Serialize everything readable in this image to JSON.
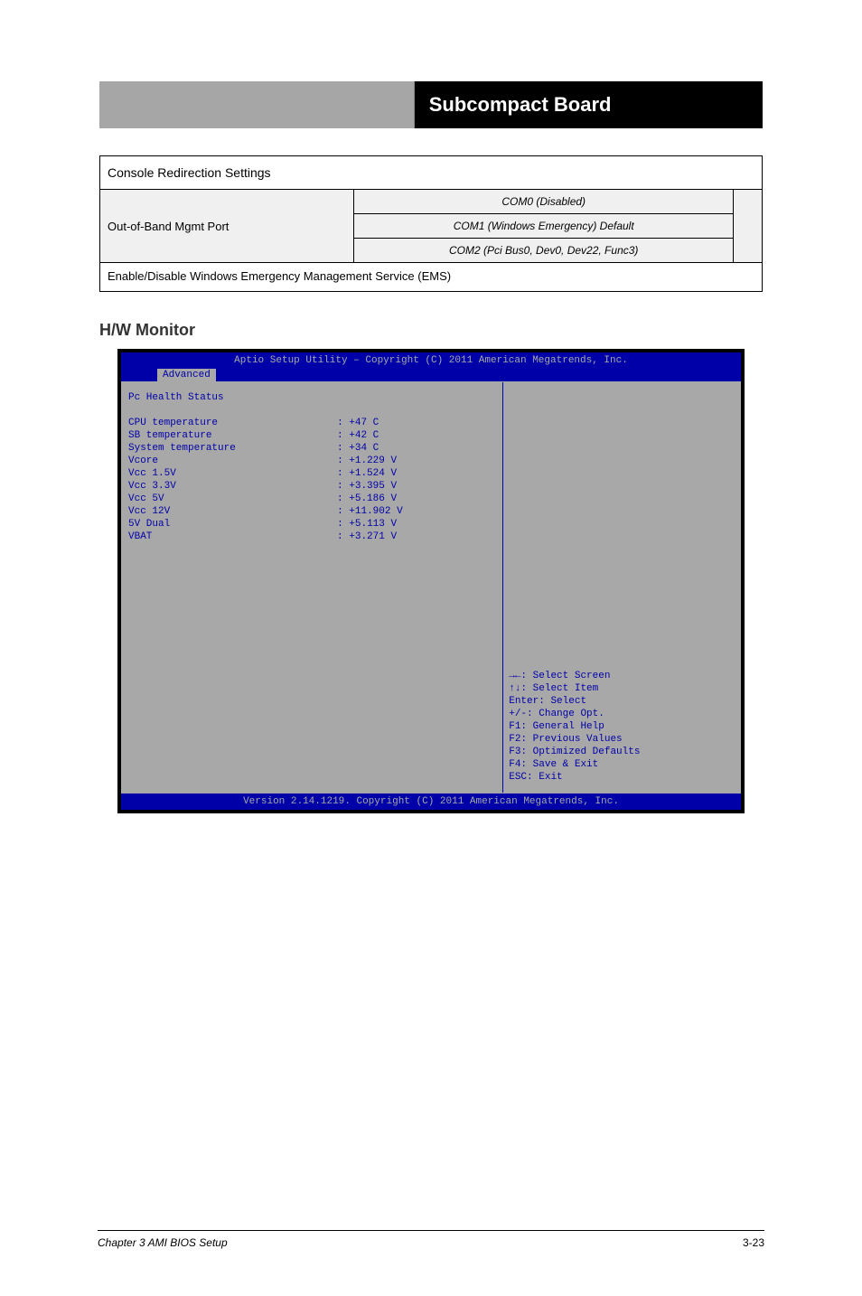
{
  "header": {
    "right": "Subcompact Board"
  },
  "config": {
    "title": "Console Redirection Settings",
    "rows": [
      {
        "label": "Out-of-Band Mgmt Port",
        "options": [
          "COM0 (Disabled)",
          "COM1 (Windows Emergency) Default",
          "COM2 (Pci Bus0, Dev0, Dev22, Func3)"
        ],
        "merged": true
      },
      {
        "label": "Enable/Disable",
        "options": [
          "Windows Emergency Management Service (EMS)"
        ],
        "merged": false
      }
    ]
  },
  "section_heading": "H/W Monitor",
  "bios": {
    "title": "Aptio Setup Utility – Copyright (C) 2011 American Megatrends, Inc.",
    "tab": "Advanced",
    "section": "Pc Health Status",
    "rows": [
      {
        "k": "CPU temperature",
        "v": ": +47 C"
      },
      {
        "k": "SB temperature",
        "v": ": +42 C"
      },
      {
        "k": "System temperature",
        "v": ": +34 C"
      },
      {
        "k": "Vcore",
        "v": ": +1.229 V"
      },
      {
        "k": "Vcc 1.5V",
        "v": ": +1.524 V"
      },
      {
        "k": "Vcc 3.3V",
        "v": ": +3.395 V"
      },
      {
        "k": "Vcc 5V",
        "v": ": +5.186 V"
      },
      {
        "k": "Vcc 12V",
        "v": ": +11.902 V"
      },
      {
        "k": "5V Dual",
        "v": ": +5.113 V"
      },
      {
        "k": "VBAT",
        "v": ": +3.271 V"
      }
    ],
    "help": {
      "l1": "→←: Select Screen",
      "l2": "↑↓: Select Item",
      "l3": "Enter: Select",
      "l4": "+/-: Change Opt.",
      "l5": "F1: General Help",
      "l6": "F2: Previous Values",
      "l7": "F3: Optimized Defaults",
      "l8": "F4: Save & Exit",
      "l9": "ESC: Exit"
    },
    "footer": "Version 2.14.1219. Copyright (C) 2011 American Megatrends, Inc."
  },
  "page_footer": {
    "chapter": "Chapter 3 AMI BIOS Setup",
    "page": "3-23"
  },
  "chart_data": {
    "type": "table",
    "title": "Pc Health Status",
    "rows": [
      [
        "CPU temperature",
        "+47 C"
      ],
      [
        "SB temperature",
        "+42 C"
      ],
      [
        "System temperature",
        "+34 C"
      ],
      [
        "Vcore",
        "+1.229 V"
      ],
      [
        "Vcc 1.5V",
        "+1.524 V"
      ],
      [
        "Vcc 3.3V",
        "+3.395 V"
      ],
      [
        "Vcc 5V",
        "+5.186 V"
      ],
      [
        "Vcc 12V",
        "+11.902 V"
      ],
      [
        "5V Dual",
        "+5.113 V"
      ],
      [
        "VBAT",
        "+3.271 V"
      ]
    ]
  }
}
